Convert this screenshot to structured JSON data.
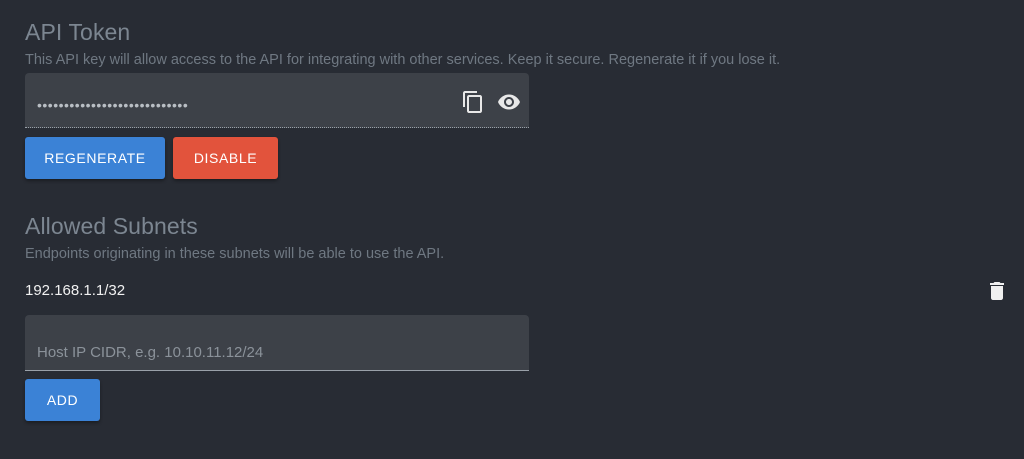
{
  "api_token": {
    "title": "API Token",
    "description": "This API key will allow access to the API for integrating with other services. Keep it secure. Regenerate it if you lose it.",
    "masked_value": "••••••••••••••••••••••••••••",
    "regenerate_label": "REGENERATE",
    "disable_label": "DISABLE",
    "icons": [
      "copy-icon",
      "eye-icon"
    ]
  },
  "allowed_subnets": {
    "title": "Allowed Subnets",
    "description": "Endpoints originating in these subnets will be able to use the API.",
    "items": [
      {
        "cidr": "192.168.1.1/32",
        "icon": "trash-icon"
      }
    ],
    "input_placeholder": "Host IP CIDR, e.g. 10.10.11.12/24",
    "input_value": "",
    "add_label": "ADD"
  },
  "colors": {
    "background": "#282c34",
    "field_background": "#3d4148",
    "primary": "#3b82d6",
    "danger": "#e2533c",
    "muted_text": "#7c8691"
  }
}
